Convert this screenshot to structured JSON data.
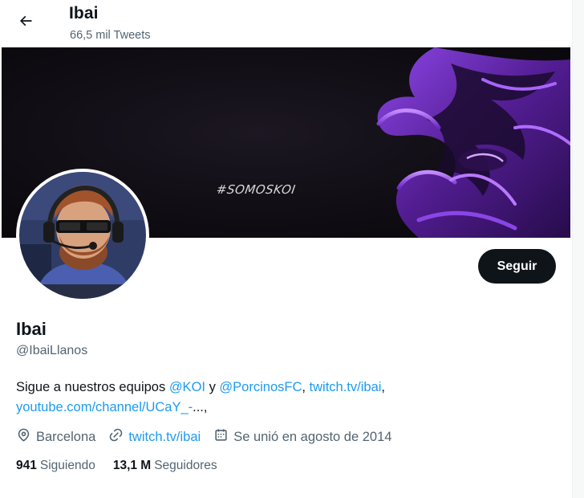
{
  "header": {
    "back_icon": "arrow-left-icon",
    "name": "Ibai",
    "tweet_count": "66,5 mil Tweets"
  },
  "banner": {
    "tag_text": "#SOMOSKOI",
    "accent_color": "#7b2bd6"
  },
  "profile": {
    "display_name": "Ibai",
    "handle": "@IbaiLlanos",
    "follow_label": "Seguir",
    "bio": {
      "prefix": "Sigue a nuestros equipos ",
      "mention_1": "@KOI",
      "conjunction": " y ",
      "mention_2": "@PorcinosFC",
      "comma": ", ",
      "link_1": "twitch.tv/ibai",
      "comma_2": ",",
      "link_2": "youtube.com/channel/UCaY_-",
      "suffix": "...,"
    },
    "location": "Barcelona",
    "website": "twitch.tv/ibai",
    "joined": "Se unió en agosto de 2014",
    "following_count": "941",
    "following_label": "Siguiendo",
    "followers_count": "13,1 M",
    "followers_label": "Seguidores"
  },
  "colors": {
    "link": "#1d9bf0",
    "text": "#0f1419",
    "secondary": "#536471",
    "button_bg": "#0f1419"
  }
}
